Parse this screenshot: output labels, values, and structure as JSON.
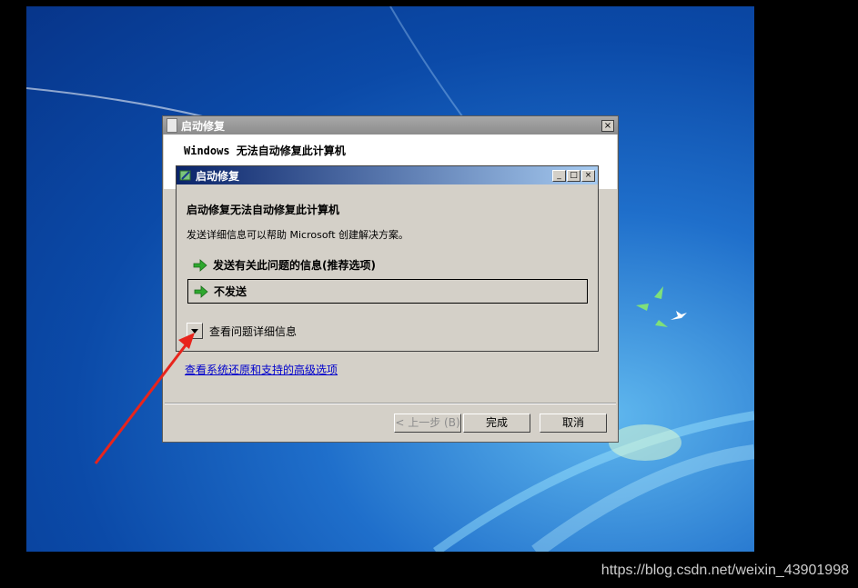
{
  "outer_window": {
    "title": "启动修复",
    "close_glyph": "×",
    "message": "Windows 无法自动修复此计算机",
    "advanced_link": "查看系统还原和支持的高级选项",
    "buttons": {
      "back": "< 上一步 (B)",
      "finish": "完成",
      "cancel": "取消"
    }
  },
  "inner_dialog": {
    "title": "启动修复",
    "controls": {
      "minimize": "_",
      "maximize": "□",
      "close": "×"
    },
    "heading": "启动修复无法自动修复此计算机",
    "description": "发送详细信息可以帮助 Microsoft 创建解决方案。",
    "options": [
      {
        "label": "发送有关此问题的信息(推荐选项)",
        "icon": "green-arrow-icon"
      },
      {
        "label": "不发送",
        "icon": "green-arrow-icon"
      }
    ],
    "details_label": "查看问题详细信息"
  },
  "watermark": "https://blog.csdn.net/weixin_43901998",
  "colors": {
    "accent_green": "#2ea82e",
    "annotation_red": "#e8241c",
    "link_blue": "#0000cc"
  }
}
